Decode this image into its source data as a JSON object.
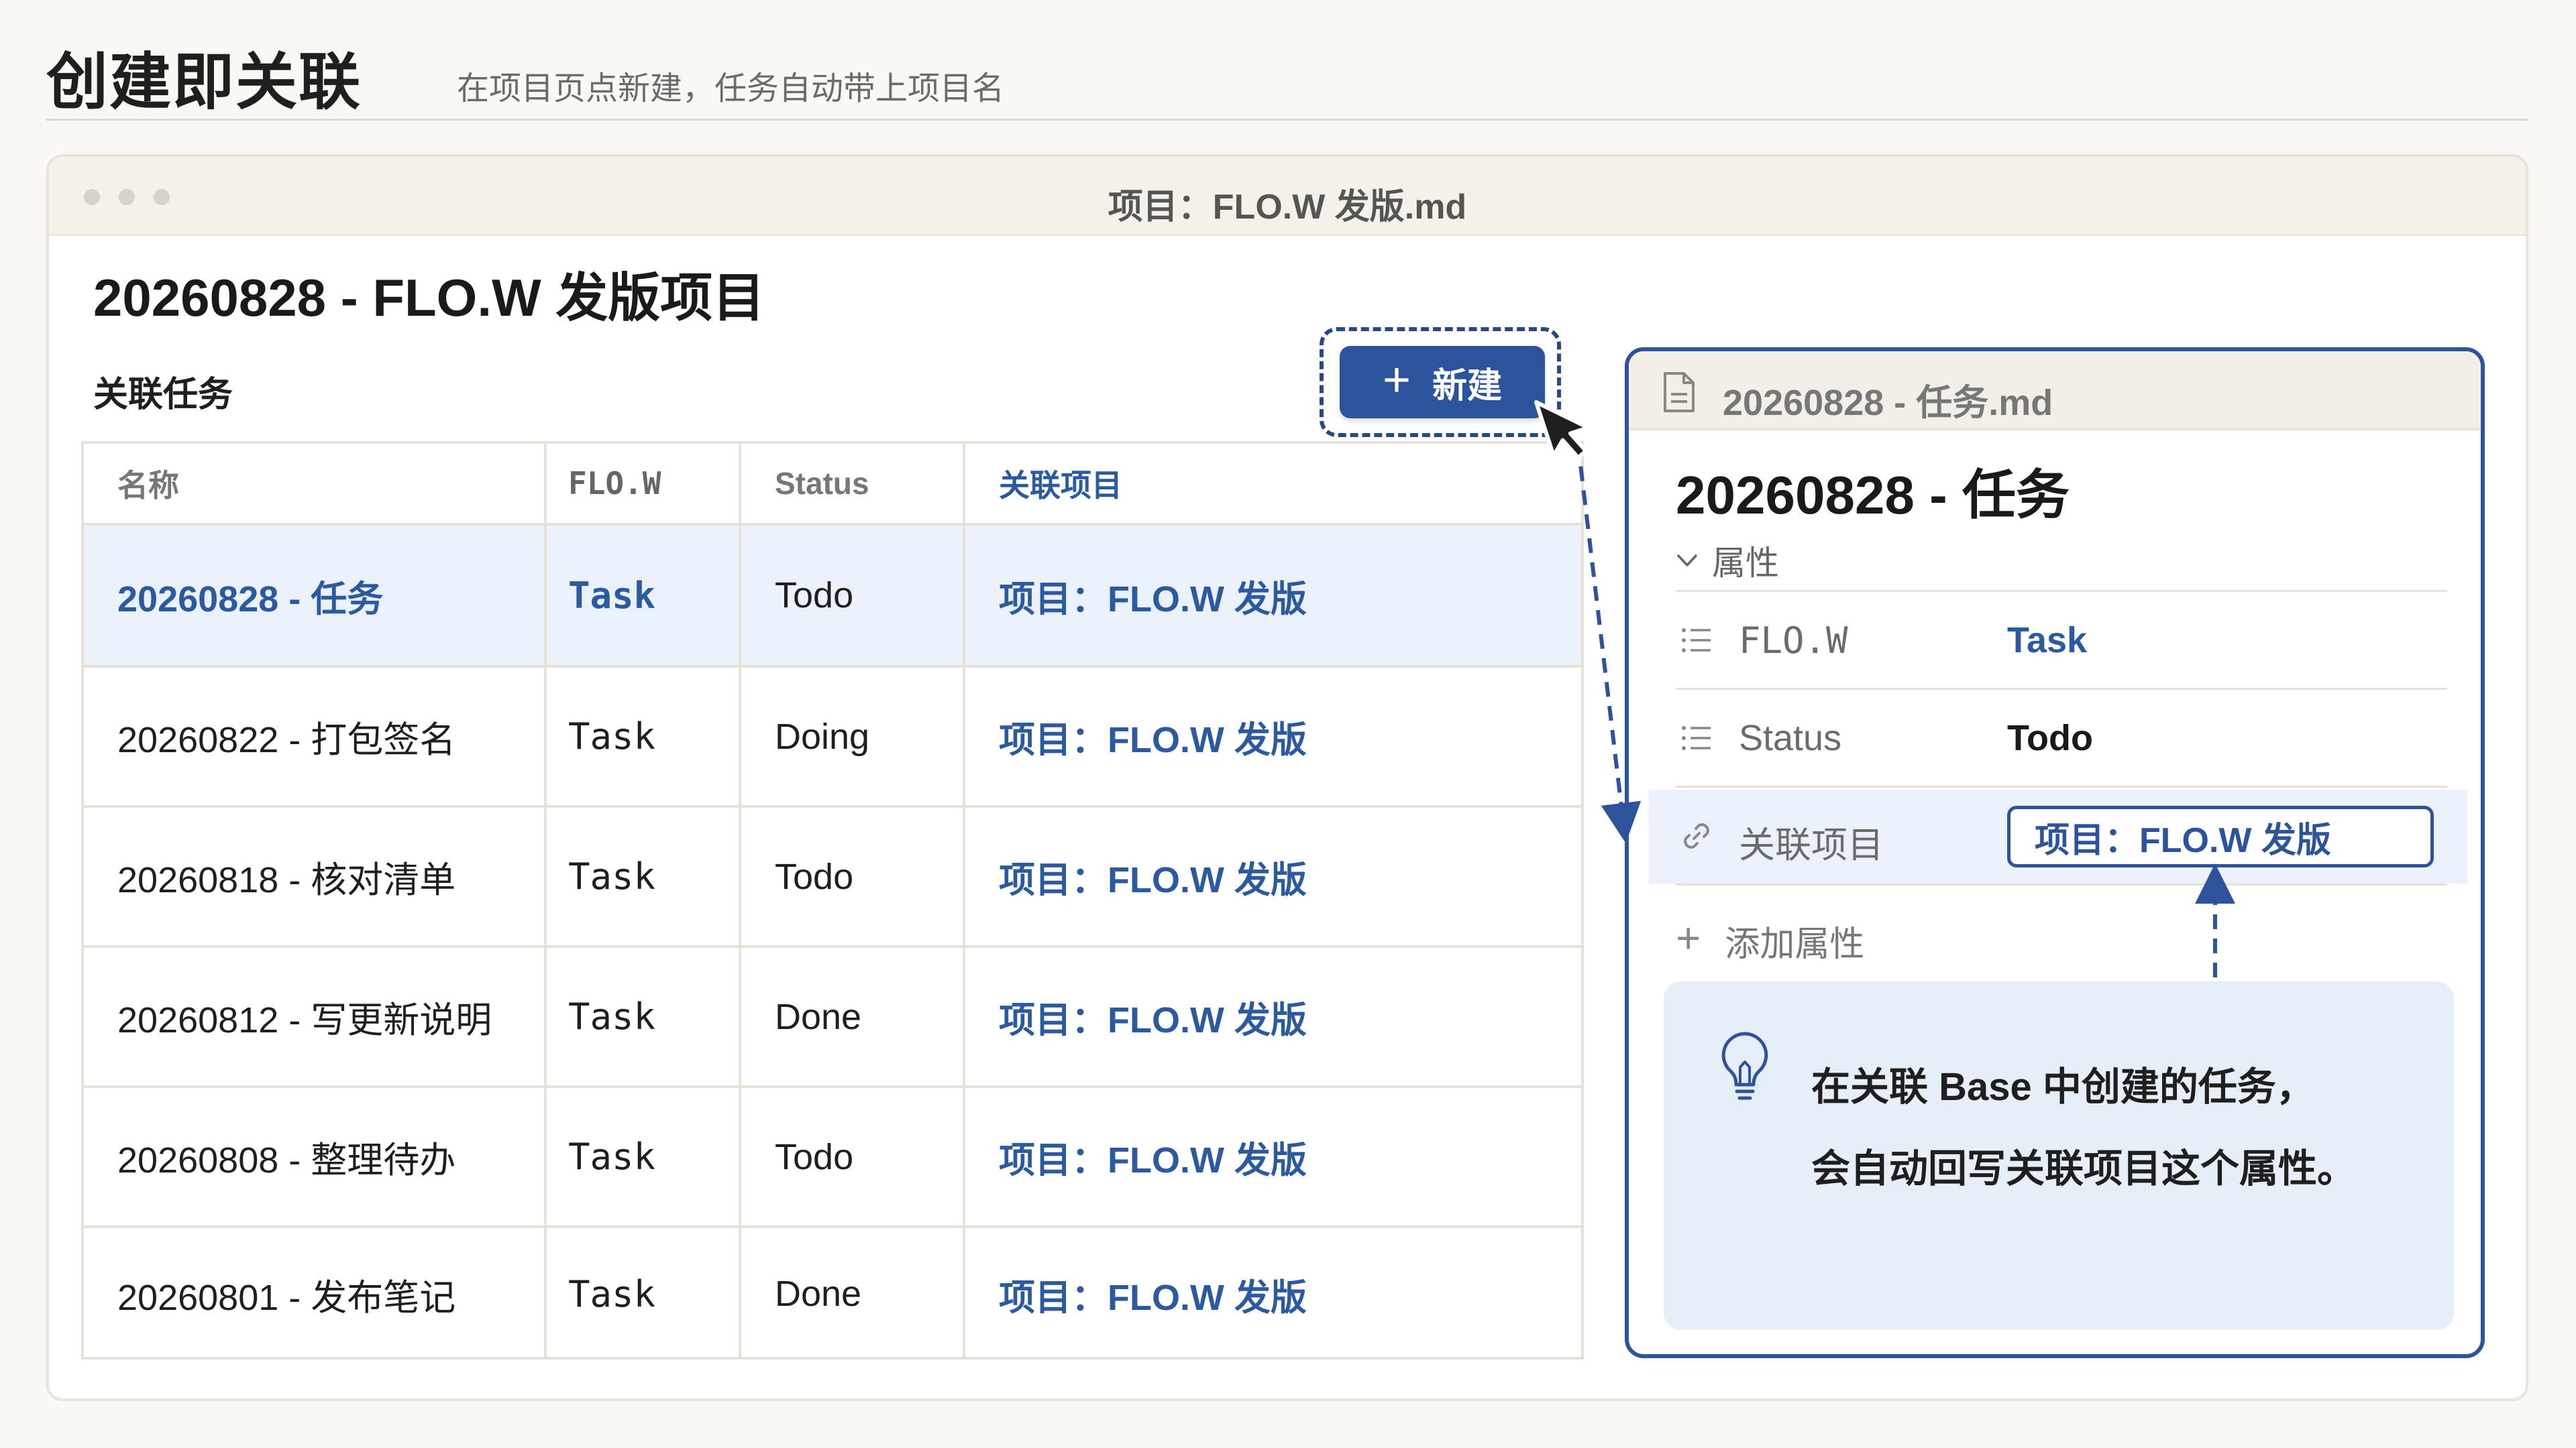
{
  "header": {
    "title": "创建即关联",
    "subtitle": "在项目页点新建，任务自动带上项目名"
  },
  "window": {
    "title": "项目：FLO.W 发版.md",
    "doc_title": "20260828 - FLO.W 发版项目",
    "section_label": "关联任务",
    "new_button_label": "新建"
  },
  "table": {
    "headers": [
      "名称",
      "FLO.W",
      "Status",
      "关联项目"
    ],
    "rows": [
      {
        "name": "20260828 - 任务",
        "flow": "Task",
        "status": "Todo",
        "project": "项目：FLO.W 发版"
      },
      {
        "name": "20260822 - 打包签名",
        "flow": "Task",
        "status": "Doing",
        "project": "项目：FLO.W 发版"
      },
      {
        "name": "20260818 - 核对清单",
        "flow": "Task",
        "status": "Todo",
        "project": "项目：FLO.W 发版"
      },
      {
        "name": "20260812 - 写更新说明",
        "flow": "Task",
        "status": "Done",
        "project": "项目：FLO.W 发版"
      },
      {
        "name": "20260808 - 整理待办",
        "flow": "Task",
        "status": "Todo",
        "project": "项目：FLO.W 发版"
      },
      {
        "name": "20260801 - 发布笔记",
        "flow": "Task",
        "status": "Done",
        "project": "项目：FLO.W 发版"
      }
    ]
  },
  "popup": {
    "file_name": "20260828 - 任务.md",
    "title": "20260828 - 任务",
    "props_label": "属性",
    "props": [
      {
        "name": "FLO.W",
        "value": "Task"
      },
      {
        "name": "Status",
        "value": "Todo"
      },
      {
        "name": "关联项目",
        "value": "项目：FLO.W 发版"
      }
    ],
    "add_prop_label": "添加属性",
    "tip_line1": "在关联 Base 中创建的任务，",
    "tip_line2": "会自动回写关联项目这个属性。"
  },
  "colors": {
    "accent": "#2c539b",
    "link": "#2c5aa0",
    "selected_row": "#eaf1fa",
    "tip_bg": "#e6eef7",
    "page_bg": "#faf8f2"
  }
}
